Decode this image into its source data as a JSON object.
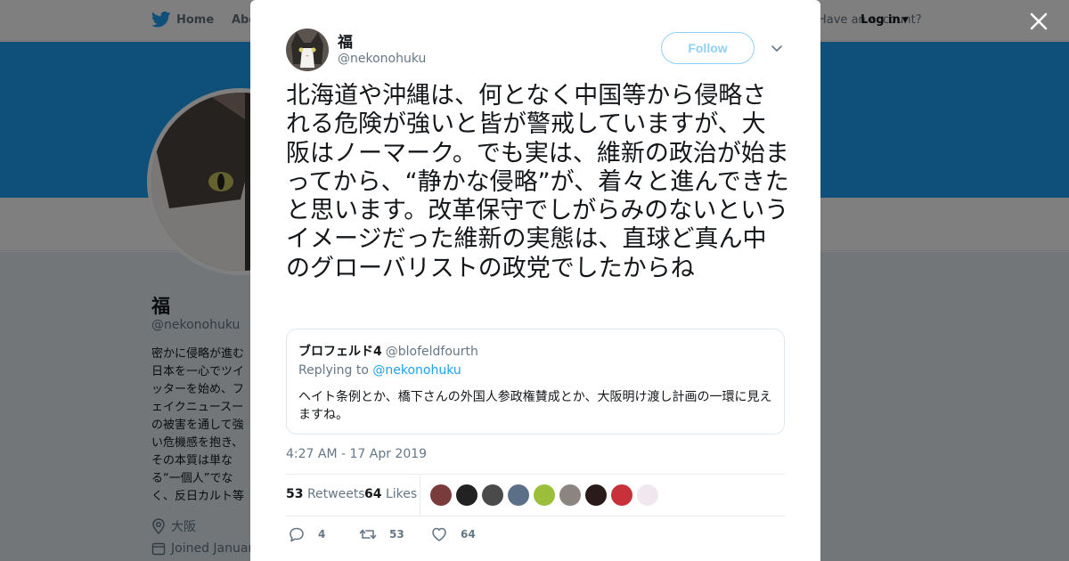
{
  "nav": {
    "home_label": "Home",
    "about_label": "About",
    "account_prompt": "Have an account?",
    "login_label": "Log in"
  },
  "profile": {
    "name": "福",
    "handle": "@nekonohuku",
    "bio": "密かに侵略が進む日本を一心でツイッターを始め、フェイクニュースーの被害を通して強い危機感を抱き、その本質は単なる“一個人”でなく、反日カルト等の政治的な活動。愛国者と協力しましょう。この被害者多し。基本",
    "location": "大阪",
    "joined": "Joined January"
  },
  "tweet": {
    "author_name": "福",
    "author_handle": "@nekonohuku",
    "follow_label": "Follow",
    "text": "北海道や沖縄は、何となく中国等から侵略される危険が強いと皆が警戒していますが、大阪はノーマーク。でも実は、維新の政治が始まってから、“静かな侵略”が、着々と進んできたと思います。改革保守でしがらみのないというイメージだった維新の実態は、直球ど真ん中のグローバリストの政党でしたからね",
    "timestamp": "4:27 AM - 17 Apr 2019",
    "retweets_count": "53",
    "retweets_label": "Retweets",
    "likes_count": "64",
    "likes_label": "Likes"
  },
  "quote": {
    "author_name": "ブロフェルド4",
    "author_handle": "@blofeldfourth",
    "replying_prefix": "Replying to",
    "replying_handle": "@nekonohuku",
    "text": "ヘイト条例とか、橋下さんの外国人参政権賛成とか、大阪明け渡し計画の一環に見えますね。"
  },
  "actions": {
    "reply_count": "4",
    "retweet_count": "53",
    "like_count": "64"
  },
  "likers": [
    {
      "color": "#7a3b3b",
      "icon": "avatar-1"
    },
    {
      "color": "#222222",
      "icon": "avatar-2"
    },
    {
      "color": "#4a4a4a",
      "icon": "avatar-3"
    },
    {
      "color": "#5b6f86",
      "icon": "avatar-4"
    },
    {
      "color": "#9bbf3a",
      "icon": "avatar-5"
    },
    {
      "color": "#8a8580",
      "icon": "avatar-6"
    },
    {
      "color": "#2a1a1a",
      "icon": "avatar-7"
    },
    {
      "color": "#c8303a",
      "icon": "avatar-8"
    },
    {
      "color": "#f0e8ee",
      "icon": "avatar-9"
    }
  ],
  "colors": {
    "accent": "#1da1f2",
    "follow_border": "#8ed0f9",
    "muted": "#657786",
    "overlay": "rgba(0,0,0,0.5)"
  }
}
